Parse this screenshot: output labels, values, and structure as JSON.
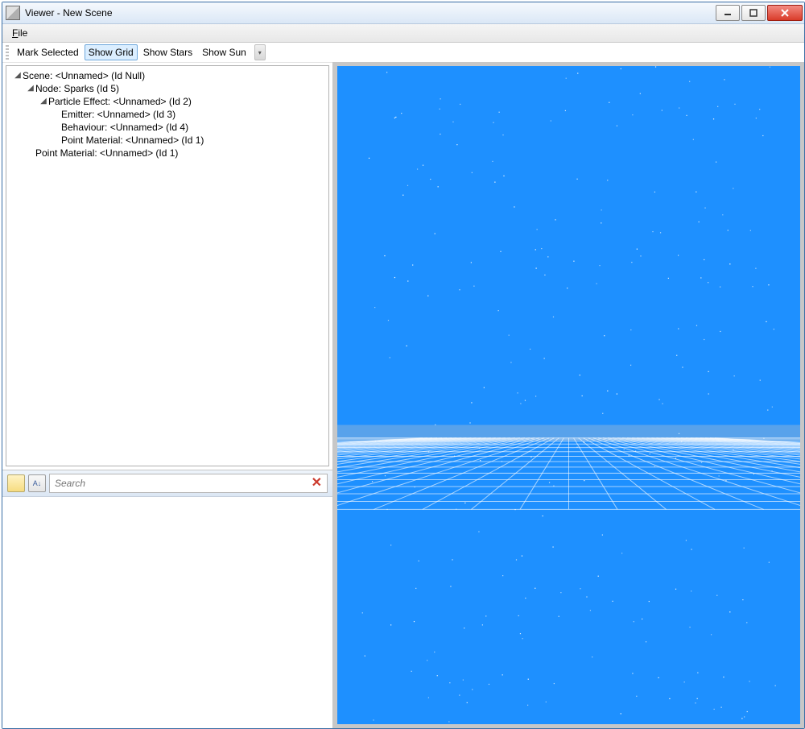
{
  "window": {
    "title": "Viewer - New Scene"
  },
  "menubar": {
    "file": "File"
  },
  "toolbar": {
    "mark_selected": "Mark Selected",
    "show_grid": "Show Grid",
    "show_stars": "Show Stars",
    "show_sun": "Show Sun",
    "active": "show_grid"
  },
  "tree": {
    "items": [
      {
        "depth": 0,
        "expand": "open",
        "label": "Scene: <Unnamed> (Id Null)"
      },
      {
        "depth": 1,
        "expand": "open",
        "label": "Node: Sparks (Id 5)"
      },
      {
        "depth": 2,
        "expand": "open",
        "label": "Particle Effect: <Unnamed> (Id 2)"
      },
      {
        "depth": 3,
        "expand": "none",
        "label": "Emitter: <Unnamed> (Id 3)"
      },
      {
        "depth": 3,
        "expand": "none",
        "label": "Behaviour: <Unnamed> (Id 4)"
      },
      {
        "depth": 3,
        "expand": "none",
        "label": "Point Material: <Unnamed> (Id 1)"
      },
      {
        "depth": 1,
        "expand": "none",
        "label": "Point Material: <Unnamed> (Id 1)"
      }
    ]
  },
  "properties": {
    "search_placeholder": "Search"
  },
  "viewport": {
    "bg_color": "#1e90ff",
    "grid_line_color": "#ffffff",
    "grid_line_opacity": 0.6,
    "particle_color": "#ffffff"
  }
}
